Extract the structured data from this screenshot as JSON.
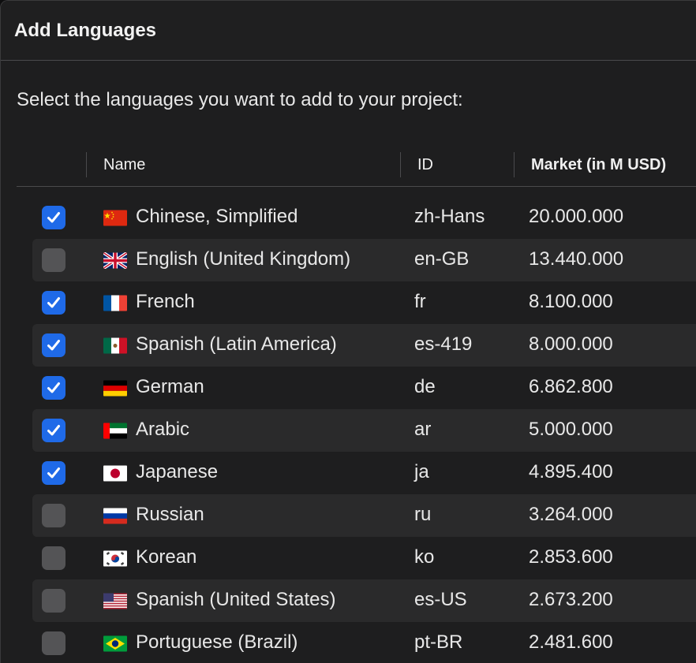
{
  "dialog": {
    "title": "Add Languages",
    "instruction": "Select the languages you want to add to your project:"
  },
  "table": {
    "columns": {
      "name": "Name",
      "id": "ID",
      "market": "Market (in M USD)"
    },
    "rows": [
      {
        "checked": true,
        "flag": "china-flag-icon",
        "name": "Chinese, Simplified",
        "id": "zh-Hans",
        "market": "20.000.000"
      },
      {
        "checked": false,
        "flag": "united-kingdom-flag-icon",
        "name": "English (United Kingdom)",
        "id": "en-GB",
        "market": "13.440.000"
      },
      {
        "checked": true,
        "flag": "france-flag-icon",
        "name": "French",
        "id": "fr",
        "market": "8.100.000"
      },
      {
        "checked": true,
        "flag": "mexico-flag-icon",
        "name": "Spanish (Latin America)",
        "id": "es-419",
        "market": "8.000.000"
      },
      {
        "checked": true,
        "flag": "germany-flag-icon",
        "name": "German",
        "id": "de",
        "market": "6.862.800"
      },
      {
        "checked": true,
        "flag": "uae-flag-icon",
        "name": "Arabic",
        "id": "ar",
        "market": "5.000.000"
      },
      {
        "checked": true,
        "flag": "japan-flag-icon",
        "name": "Japanese",
        "id": "ja",
        "market": "4.895.400"
      },
      {
        "checked": false,
        "flag": "russia-flag-icon",
        "name": "Russian",
        "id": "ru",
        "market": "3.264.000"
      },
      {
        "checked": false,
        "flag": "south-korea-flag-icon",
        "name": "Korean",
        "id": "ko",
        "market": "2.853.600"
      },
      {
        "checked": false,
        "flag": "united-states-flag-icon",
        "name": "Spanish (United States)",
        "id": "es-US",
        "market": "2.673.200"
      },
      {
        "checked": false,
        "flag": "brazil-flag-icon",
        "name": "Portuguese (Brazil)",
        "id": "pt-BR",
        "market": "2.481.600"
      }
    ]
  },
  "colors": {
    "checkbox_on": "#1f6ae8",
    "checkbox_off": "#545456",
    "row_alt": "#2a2a2b",
    "background": "#1e1e1f"
  }
}
